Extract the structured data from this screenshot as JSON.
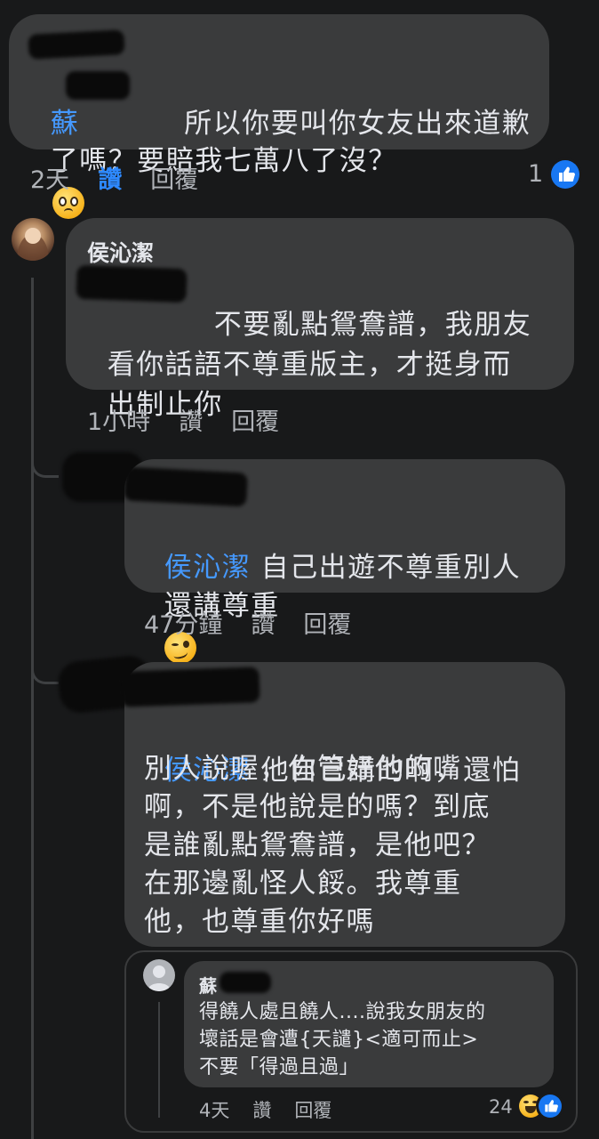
{
  "comments": [
    {
      "author_prefix": "蘇",
      "text_line1": "所以你要叫你女友出來道歉",
      "text_line2": "了嗎？要賠我七萬八了沒？",
      "emoji": "pleading-face",
      "time": "2天",
      "like_label": "讚",
      "reply_label": "回覆",
      "reaction_count": "1",
      "liked": true
    },
    {
      "author": "侯沁潔",
      "text_line1": "不要亂點鴛鴦譜，我朋友",
      "text_line2": "看你話語不尊重版主，才挺身而",
      "text_line3": "出制止你",
      "time": "1小時",
      "like_label": "讚",
      "reply_label": "回覆"
    },
    {
      "mention": "侯沁潔",
      "text_line1": "自己出遊不尊重別人",
      "text_line2": "還講尊重",
      "emoji": "woozy-face",
      "time": "47分鐘",
      "like_label": "讚",
      "reply_label": "回覆"
    },
    {
      "mention": "侯沁潔",
      "text_line1": "他自己講的啊，還怕",
      "text_line2": "別人說喔，你管好他的嘴",
      "text_line3": "啊，不是他說是的嗎？到底",
      "text_line4": "是誰亂點鴛鴦譜，是他吧？",
      "text_line5": "在那邊亂怪人餒。我尊重",
      "text_line6": "他，也尊重你好嗎"
    }
  ],
  "nested": {
    "author_prefix": "蘇",
    "text_line1": "得饒人處且饒人....說我女朋友的",
    "text_line2": "壞話是會遭{天譴}<適可而止>",
    "text_line3": "不要「得過且過」",
    "time": "4天",
    "like_label": "讚",
    "reply_label": "回覆",
    "reaction_count": "24",
    "reactions": [
      "haha-icon",
      "like-icon"
    ]
  },
  "colors": {
    "background": "#18191a",
    "bubble": "#3a3b3c",
    "mention": "#4599ff",
    "liked": "#2e89ff",
    "secondary_text": "#b0b3b8",
    "like_badge": "#1877f2"
  }
}
